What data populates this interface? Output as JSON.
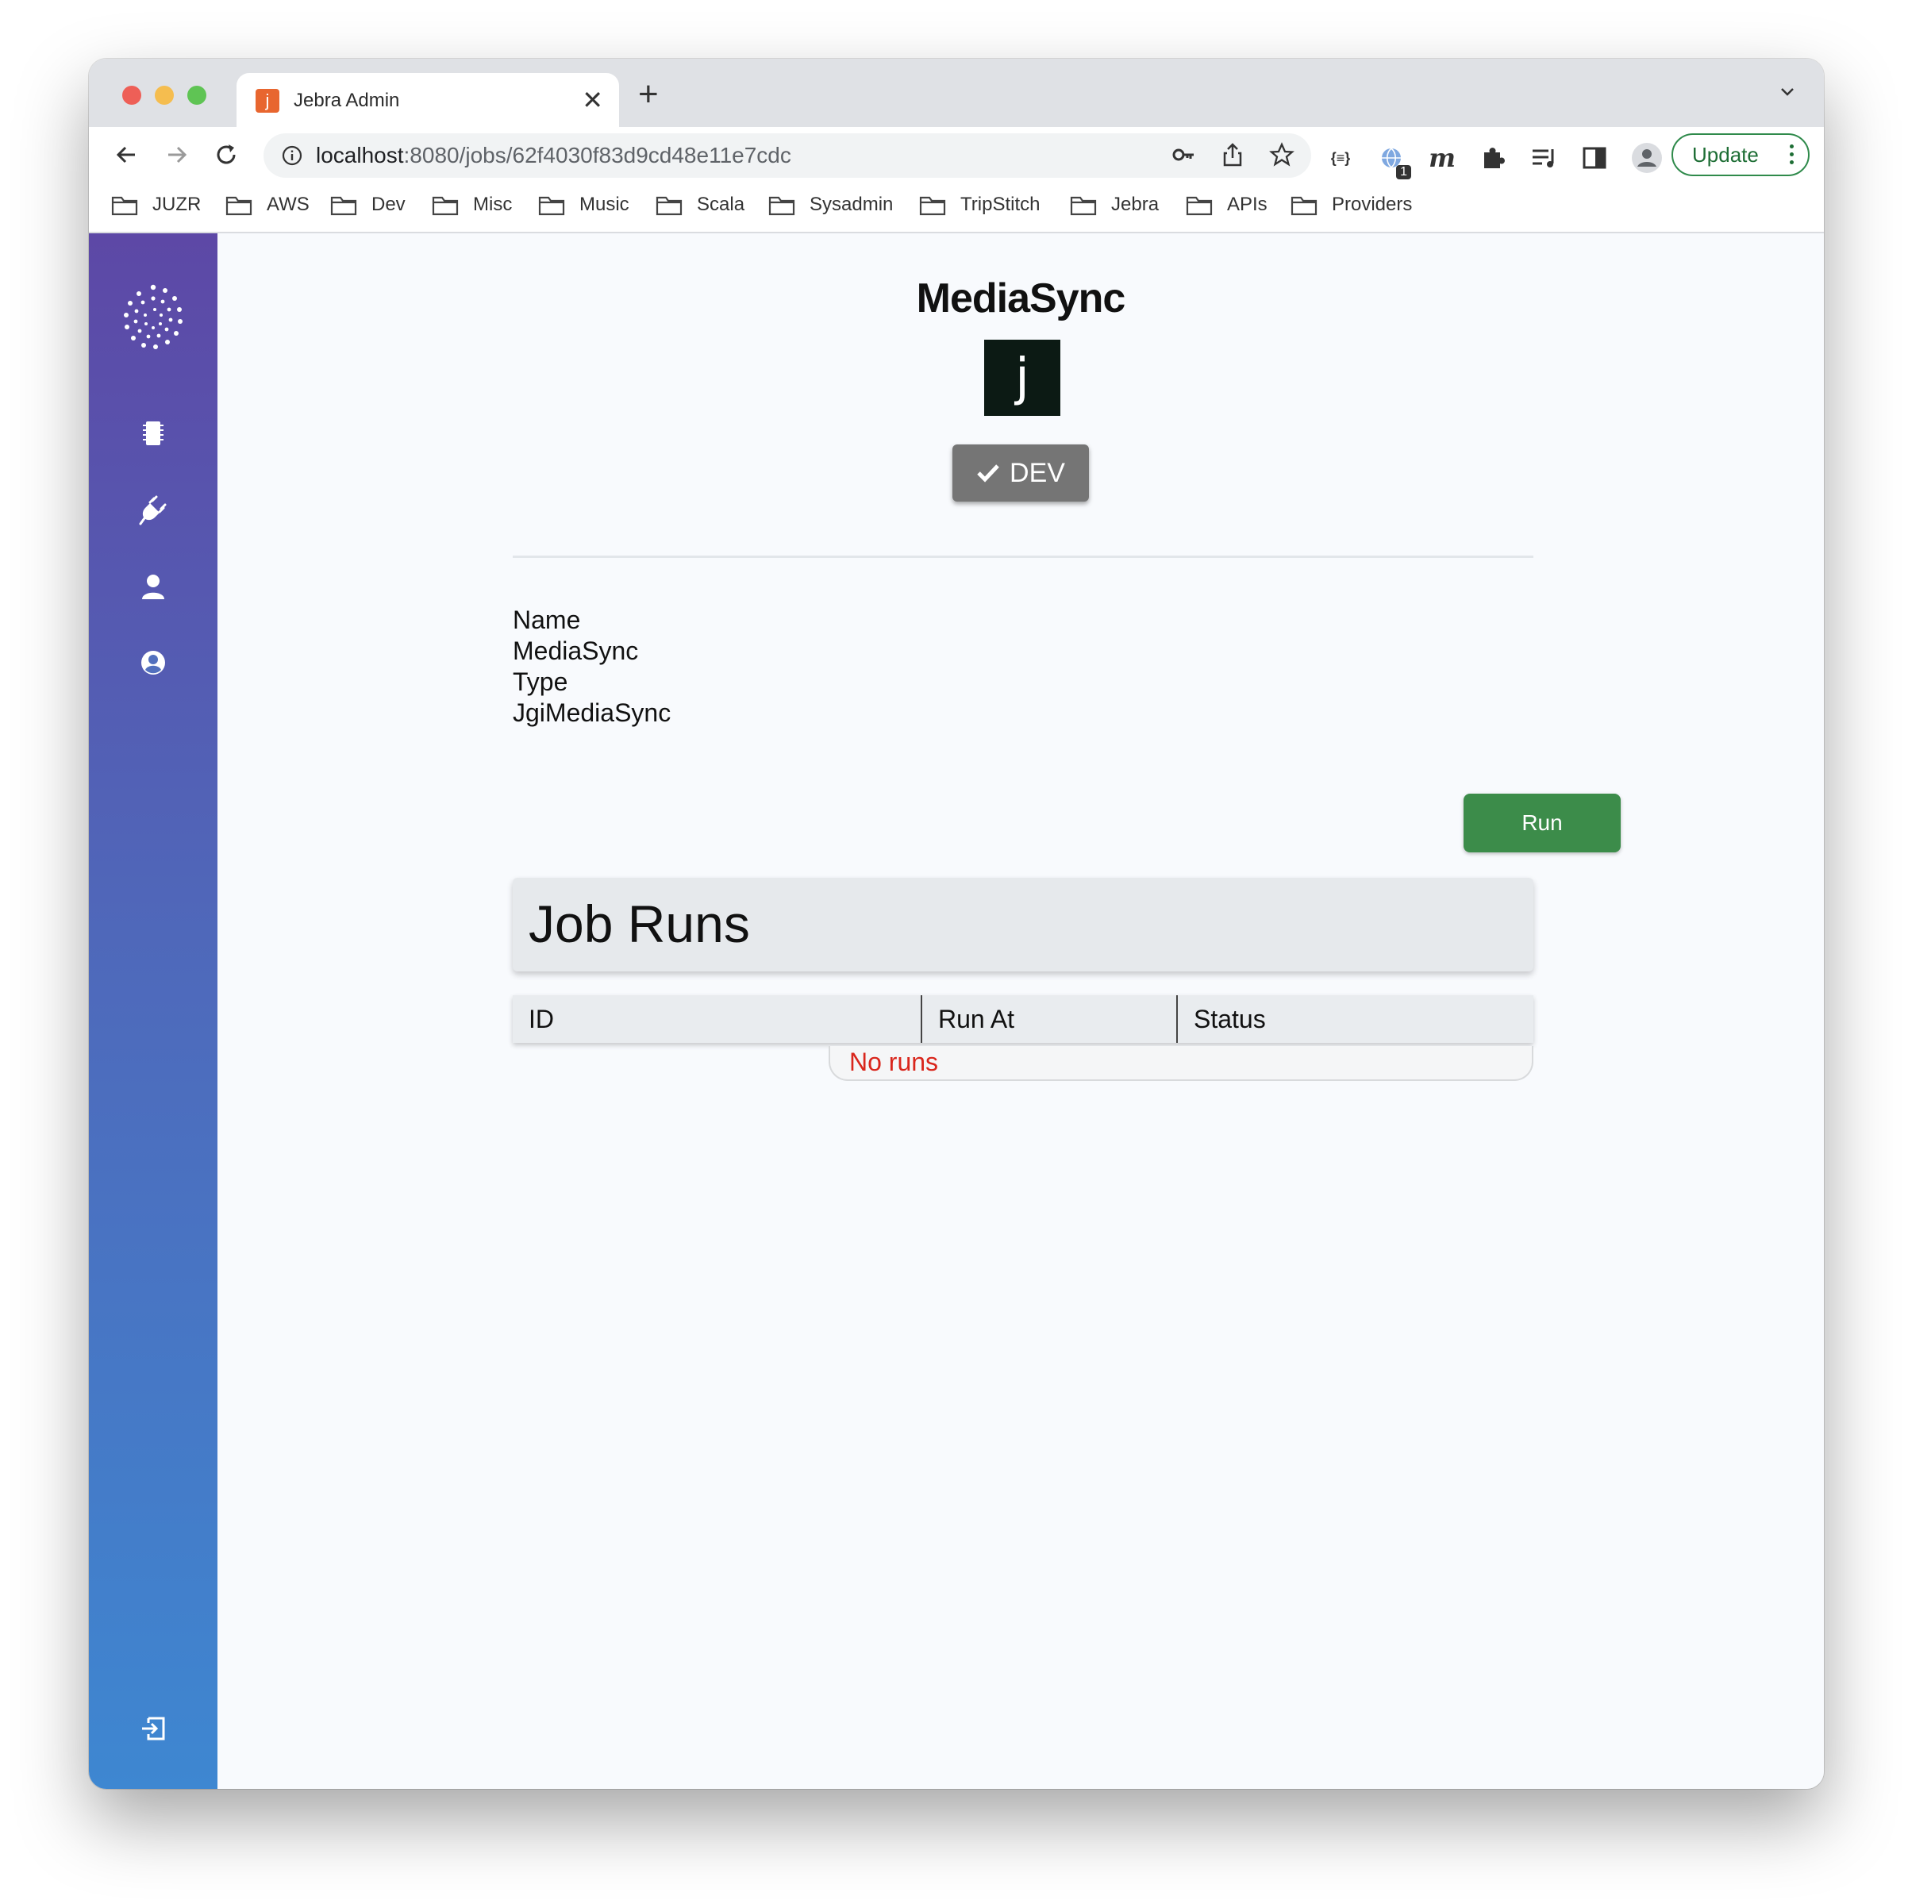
{
  "browser": {
    "tab_title": "Jebra Admin",
    "tab_favicon_letter": "j",
    "url_host": "localhost",
    "url_rest": ":8080/jobs/62f4030f83d9cd48e11e7cdc",
    "update_label": "Update",
    "extension_badge": "1",
    "bookmarks": [
      "JUZR",
      "AWS",
      "Dev",
      "Misc",
      "Music",
      "Scala",
      "Sysadmin",
      "TripStitch",
      "Jebra",
      "APIs",
      "Providers"
    ]
  },
  "job": {
    "title": "MediaSync",
    "logo_letter": "j",
    "env_label": "DEV",
    "name_label": "Name",
    "name_value": "MediaSync",
    "type_label": "Type",
    "type_value": "JgiMediaSync",
    "run_label": "Run"
  },
  "runs": {
    "title": "Job Runs",
    "columns": [
      "ID",
      "Run At",
      "Status"
    ],
    "empty_text": "No runs"
  },
  "colors": {
    "sidebar_top": "#5d48a6",
    "sidebar_bottom": "#3e87d1",
    "run_button": "#3c8c4a",
    "empty_text": "#d9261c"
  }
}
